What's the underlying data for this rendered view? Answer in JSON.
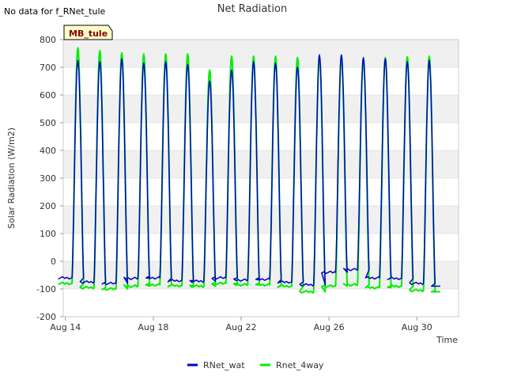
{
  "header": {
    "no_data_text": "No data for f_RNet_tule",
    "site_label": "MB_tule"
  },
  "colors": {
    "rnet_wat": "#0000cc",
    "rnet_4way": "#00ee00",
    "band": "#f0f0f0",
    "site_bg": "#ffffcc"
  },
  "chart_data": {
    "type": "line",
    "title": "Net Radiation",
    "xlabel": "Time",
    "ylabel": "Solar Radiation (W/m2)",
    "xlim": [
      13.9,
      31.9
    ],
    "ylim": [
      -200,
      800
    ],
    "x_ticks": [
      14,
      18,
      22,
      26,
      30
    ],
    "x_tick_labels": [
      "Aug 14",
      "Aug 18",
      "Aug 22",
      "Aug 26",
      "Aug 30"
    ],
    "y_ticks": [
      -200,
      -100,
      0,
      100,
      200,
      300,
      400,
      500,
      600,
      700,
      800
    ],
    "y_tick_labels": [
      "-200",
      "-100",
      "0",
      "100",
      "200",
      "300",
      "400",
      "500",
      "600",
      "700",
      "800"
    ],
    "grid": true,
    "legend_position": "bottom",
    "x_unit": "days in August (day of month)",
    "series": [
      {
        "name": "RNet_wat",
        "color": "#0000cc",
        "daily_peaks": [
          725,
          720,
          730,
          715,
          720,
          710,
          650,
          690,
          720,
          715,
          700,
          745,
          745,
          735,
          730,
          720,
          725
        ],
        "night_values": [
          -60,
          -75,
          -80,
          -62,
          -60,
          -70,
          -72,
          -60,
          -68,
          -65,
          -75,
          -85,
          -40,
          -30,
          -60,
          -62,
          -80,
          -90
        ]
      },
      {
        "name": "Rnet_4way",
        "color": "#00ee00",
        "daily_peaks": [
          770,
          760,
          752,
          748,
          748,
          748,
          690,
          740,
          740,
          740,
          735,
          738,
          738,
          730,
          735,
          738,
          740
        ],
        "night_values": [
          -80,
          -95,
          -100,
          -90,
          -85,
          -88,
          -90,
          -80,
          -85,
          -85,
          -90,
          -110,
          -90,
          -85,
          -95,
          -90,
          -105,
          -110
        ]
      }
    ]
  },
  "legend": {
    "items": [
      {
        "label": "RNet_wat",
        "color": "#0000cc"
      },
      {
        "label": "Rnet_4way",
        "color": "#00ee00"
      }
    ]
  }
}
